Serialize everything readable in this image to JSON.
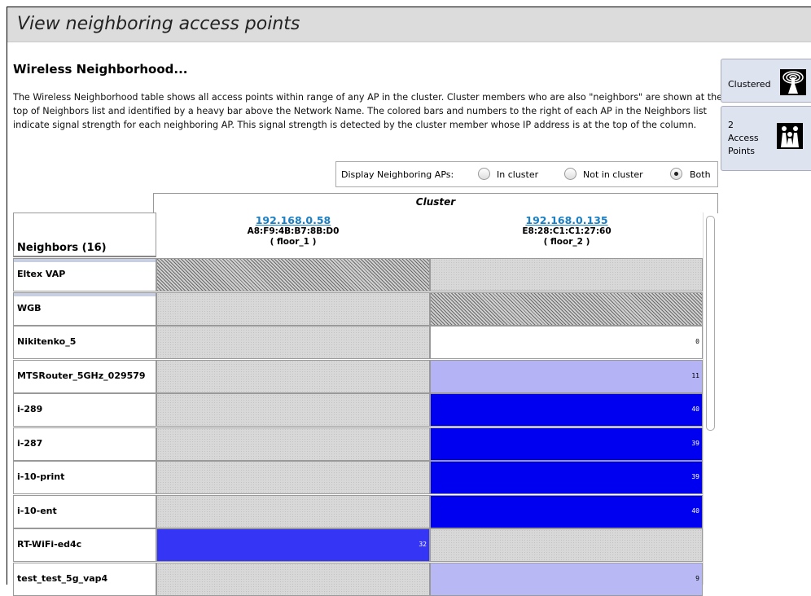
{
  "page_title": "View neighboring access points",
  "section_heading": "Wireless Neighborhood...",
  "description": "The Wireless Neighborhood table shows all access points within range of any AP in the cluster. Cluster members who are also \"neighbors\" are shown at the top of Neighbors list and identified by a heavy bar above the Network Name. The colored bars and numbers to the right of each AP in the Neighbors list indicate signal strength for each neighboring AP. This signal strength is detected by the cluster member whose IP address is at the top of the column.",
  "side_panels": {
    "clustered": {
      "label": "Clustered",
      "icon": "cluster-signal-icon"
    },
    "access_points": {
      "count": "2",
      "label1": "Access",
      "label2": "Points",
      "icon": "access-points-icon"
    }
  },
  "display_filter": {
    "label": "Display Neighboring APs:",
    "options": [
      "In cluster",
      "Not in cluster",
      "Both"
    ],
    "selected": "Both"
  },
  "table": {
    "cluster_title": "Cluster",
    "neighbors_header": "Neighbors (16)",
    "members": [
      {
        "ip": "192.168.0.58",
        "mac": "A8:F9:4B:B7:8B:D0",
        "location": "( floor_1 )"
      },
      {
        "ip": "192.168.0.135",
        "mac": "E8:28:C1:C1:27:60",
        "location": "( floor_2 )"
      }
    ],
    "rows": [
      {
        "name": "Eltex VAP",
        "cluster_member": true,
        "cells": [
          {
            "state": "self"
          },
          {
            "state": "none"
          }
        ]
      },
      {
        "name": "WGB",
        "cluster_member": true,
        "cells": [
          {
            "state": "none"
          },
          {
            "state": "self"
          }
        ]
      },
      {
        "name": "Nikitenko_5",
        "cluster_member": false,
        "cells": [
          {
            "state": "none"
          },
          {
            "state": "signal",
            "value": "0",
            "color": "#ffffff"
          }
        ]
      },
      {
        "name": "MTSRouter_5GHz_029579",
        "cluster_member": false,
        "cells": [
          {
            "state": "none"
          },
          {
            "state": "signal",
            "value": "11",
            "color": "#b3b3f5"
          }
        ]
      },
      {
        "name": "i-289",
        "cluster_member": false,
        "cells": [
          {
            "state": "none"
          },
          {
            "state": "signal",
            "value": "40",
            "color": "#0000f0"
          }
        ]
      },
      {
        "name": "i-287",
        "cluster_member": false,
        "cells": [
          {
            "state": "none"
          },
          {
            "state": "signal",
            "value": "39",
            "color": "#0000f0"
          }
        ]
      },
      {
        "name": "i-10-print",
        "cluster_member": false,
        "cells": [
          {
            "state": "none"
          },
          {
            "state": "signal",
            "value": "39",
            "color": "#0000f0"
          }
        ]
      },
      {
        "name": "i-10-ent",
        "cluster_member": false,
        "cells": [
          {
            "state": "none"
          },
          {
            "state": "signal",
            "value": "40",
            "color": "#0000f0"
          }
        ]
      },
      {
        "name": "RT-WiFi-ed4c",
        "cluster_member": false,
        "cells": [
          {
            "state": "signal",
            "value": "32",
            "color": "#3535f5"
          },
          {
            "state": "none"
          }
        ]
      },
      {
        "name": "test_test_5g_vap4",
        "cluster_member": false,
        "cells": [
          {
            "state": "none"
          },
          {
            "state": "signal",
            "value": "9",
            "color": "#b8b8f5"
          }
        ]
      }
    ]
  }
}
